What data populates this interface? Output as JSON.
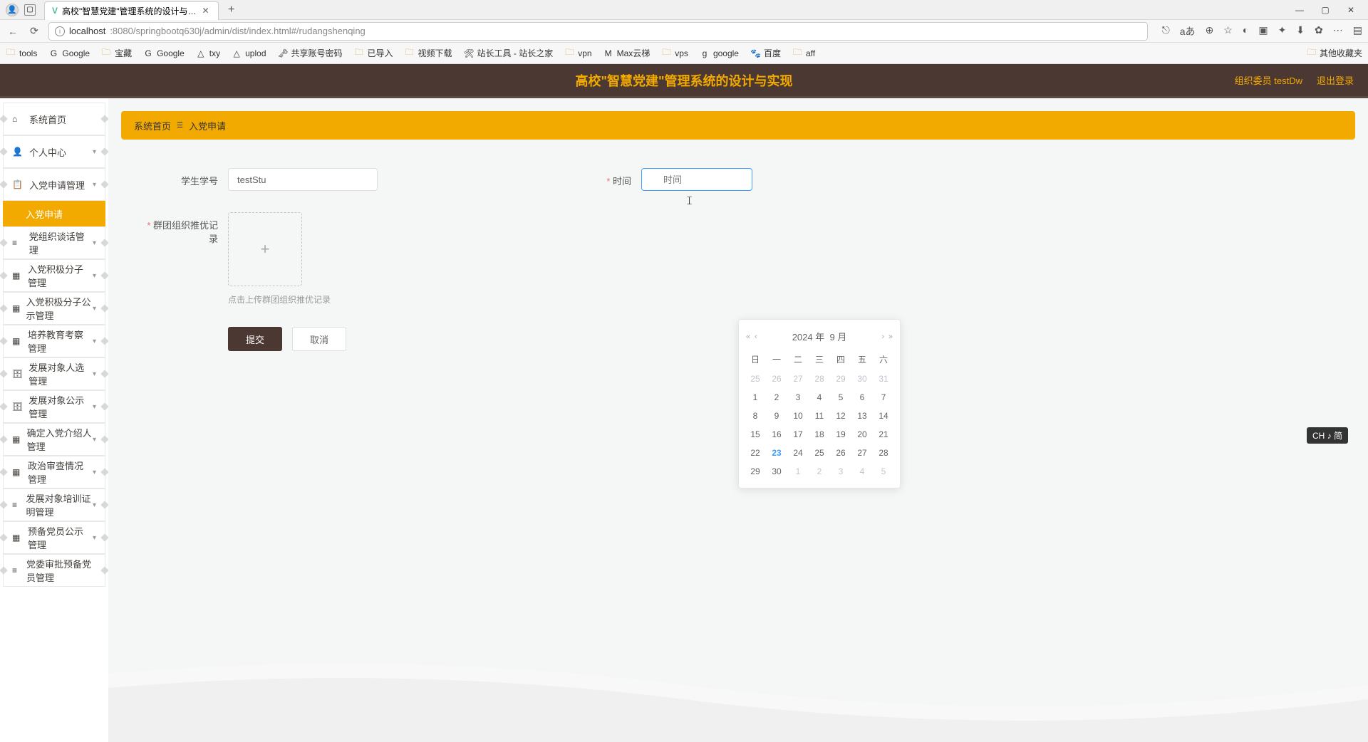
{
  "browser": {
    "tab_title": "高校\"智慧党建\"管理系统的设计与…",
    "url_host": "localhost",
    "url_port_path": ":8080/springbootq630j/admin/dist/index.html#/rudangshenqing",
    "bookmarks": [
      "tools",
      "Google",
      "宝藏",
      "Google",
      "txy",
      "uplod",
      "共享账号密码",
      "已导入",
      "视频下载",
      "站长工具 - 站长之家",
      "vpn",
      "Max云梯",
      "vps",
      "google",
      "百度",
      "aff"
    ],
    "other_bookmarks": "其他收藏夹"
  },
  "app": {
    "title": "高校\"智慧党建\"管理系统的设计与实现",
    "user_label": "组织委员 testDw",
    "logout": "退出登录"
  },
  "sidebar": {
    "items": [
      {
        "label": "系统首页",
        "icon": "⌂",
        "chev": false
      },
      {
        "label": "个人中心",
        "icon": "👤",
        "chev": true
      },
      {
        "label": "入党申请管理",
        "icon": "📋",
        "chev": true,
        "sub": "入党申请"
      },
      {
        "label": "党组织谈话管理",
        "icon": "≡",
        "chev": true
      },
      {
        "label": "入党积极分子管理",
        "icon": "▦",
        "chev": true
      },
      {
        "label": "入党积极分子公示管理",
        "icon": "▦",
        "chev": true
      },
      {
        "label": "培养教育考察管理",
        "icon": "▦",
        "chev": true
      },
      {
        "label": "发展对象人选管理",
        "icon": "🗄",
        "chev": true
      },
      {
        "label": "发展对象公示管理",
        "icon": "🗄",
        "chev": true
      },
      {
        "label": "确定入党介绍人管理",
        "icon": "▦",
        "chev": true
      },
      {
        "label": "政治审查情况管理",
        "icon": "▦",
        "chev": true
      },
      {
        "label": "发展对象培训证明管理",
        "icon": "≡",
        "chev": true
      },
      {
        "label": "预备党员公示管理",
        "icon": "▦",
        "chev": true
      },
      {
        "label": "党委审批预备党员管理",
        "icon": "≡",
        "chev": false
      }
    ]
  },
  "breadcrumb": {
    "home": "系统首页",
    "current": "入党申请"
  },
  "form": {
    "student_label": "学生学号",
    "student_value": "testStu",
    "upload_label": "群团组织推优记录",
    "upload_hint": "点击上传群团组织推优记录",
    "time_label": "时间",
    "time_placeholder": "时间",
    "submit": "提交",
    "cancel": "取消"
  },
  "datepicker": {
    "year": "2024 年",
    "month": "9 月",
    "weekdays": [
      "日",
      "一",
      "二",
      "三",
      "四",
      "五",
      "六"
    ],
    "rows": [
      [
        {
          "d": 25,
          "o": true
        },
        {
          "d": 26,
          "o": true
        },
        {
          "d": 27,
          "o": true
        },
        {
          "d": 28,
          "o": true
        },
        {
          "d": 29,
          "o": true
        },
        {
          "d": 30,
          "o": true
        },
        {
          "d": 31,
          "o": true
        }
      ],
      [
        {
          "d": 1
        },
        {
          "d": 2
        },
        {
          "d": 3
        },
        {
          "d": 4
        },
        {
          "d": 5
        },
        {
          "d": 6
        },
        {
          "d": 7
        }
      ],
      [
        {
          "d": 8
        },
        {
          "d": 9
        },
        {
          "d": 10
        },
        {
          "d": 11
        },
        {
          "d": 12
        },
        {
          "d": 13
        },
        {
          "d": 14
        }
      ],
      [
        {
          "d": 15
        },
        {
          "d": 16
        },
        {
          "d": 17
        },
        {
          "d": 18
        },
        {
          "d": 19
        },
        {
          "d": 20
        },
        {
          "d": 21
        }
      ],
      [
        {
          "d": 22
        },
        {
          "d": 23,
          "t": true
        },
        {
          "d": 24
        },
        {
          "d": 25
        },
        {
          "d": 26
        },
        {
          "d": 27
        },
        {
          "d": 28
        }
      ],
      [
        {
          "d": 29
        },
        {
          "d": 30
        },
        {
          "d": 1,
          "o": true
        },
        {
          "d": 2,
          "o": true
        },
        {
          "d": 3,
          "o": true
        },
        {
          "d": 4,
          "o": true
        },
        {
          "d": 5,
          "o": true
        }
      ]
    ]
  },
  "ime": "CH ♪ 简"
}
